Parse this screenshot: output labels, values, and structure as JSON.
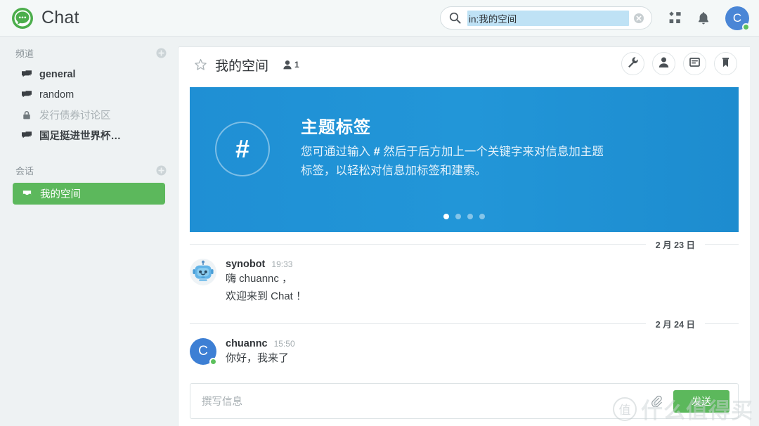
{
  "app": {
    "brand_name": "Chat",
    "logo_icon": "chat-bubble-logo"
  },
  "search": {
    "value": "in:我的空间",
    "icon": "search-icon",
    "clear_icon": "clear-icon"
  },
  "topbar": {
    "apps_icon": "apps-grid-icon",
    "notifications_icon": "bell-icon",
    "avatar_initial": "C",
    "avatar_color": "#4a86d6",
    "status_color": "#5cc05c"
  },
  "sidebar": {
    "channels": {
      "title": "频道",
      "add_icon": "plus-circle-icon",
      "items": [
        {
          "label": "general",
          "icon": "channel-icon",
          "unread": true,
          "muted": false
        },
        {
          "label": "random",
          "icon": "channel-icon",
          "unread": false,
          "muted": false
        },
        {
          "label": "发行债券讨论区",
          "icon": "lock-icon",
          "unread": false,
          "muted": true
        },
        {
          "label": "国足挺进世界杯…",
          "icon": "channel-icon",
          "unread": true,
          "muted": false
        }
      ]
    },
    "conversations": {
      "title": "会话",
      "add_icon": "plus-circle-icon",
      "items": [
        {
          "label": "我的空间",
          "icon": "inbox-icon",
          "active": true
        }
      ]
    },
    "active_color": "#5cb85c"
  },
  "channel_header": {
    "star_icon": "star-icon",
    "title": "我的空间",
    "member_icon": "person-icon",
    "member_count": "1",
    "actions": [
      {
        "icon": "wrench-icon",
        "name": "settings-button"
      },
      {
        "icon": "person-icon",
        "name": "members-button"
      },
      {
        "icon": "notes-icon",
        "name": "notes-button"
      },
      {
        "icon": "bookmark-icon",
        "name": "bookmark-button"
      }
    ]
  },
  "banner": {
    "icon": "hash-icon",
    "icon_glyph": "#",
    "title": "主题标签",
    "body_before": "您可通过输入 ",
    "body_mark": "#",
    "body_after": " 然后于后方加上一个关键字来对信息加主题标签，以轻松对信息加标签和建索。",
    "background_color": "#2296d8",
    "dots_total": 4,
    "dots_active_index": 0
  },
  "messages": [
    {
      "type": "date_separator",
      "label": "2 月 23 日"
    },
    {
      "type": "message",
      "author": "synobot",
      "time": "19:33",
      "avatar": "robot-avatar",
      "online": false,
      "lines": [
        "嗨 chuannc ，",
        "欢迎来到 Chat ！"
      ]
    },
    {
      "type": "date_separator",
      "label": "2 月 24 日"
    },
    {
      "type": "message",
      "author": "chuannc",
      "time": "15:50",
      "avatar": "letter-avatar",
      "avatar_initial": "C",
      "online": true,
      "lines": [
        "你好，我来了"
      ]
    }
  ],
  "composer": {
    "placeholder": "撰写信息",
    "attach_icon": "paperclip-icon",
    "send_label": "发送",
    "send_color": "#5cb85c"
  },
  "watermark": {
    "badge": "值",
    "text": "什么值得买"
  }
}
